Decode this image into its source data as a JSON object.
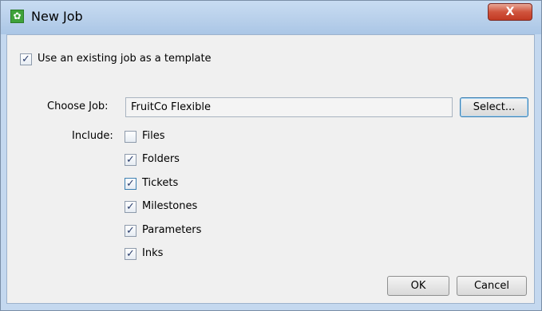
{
  "window": {
    "title": "New Job",
    "app_icon_glyph": "✿",
    "close_glyph": "X"
  },
  "template_option": {
    "label": "Use an existing job as a template",
    "checked": true
  },
  "choose_job": {
    "label": "Choose Job:",
    "value": "FruitCo Flexible",
    "select_label": "Select..."
  },
  "include": {
    "label": "Include:",
    "items": [
      {
        "label": "Files",
        "checked": false
      },
      {
        "label": "Folders",
        "checked": true
      },
      {
        "label": "Tickets",
        "checked": true
      },
      {
        "label": "Milestones",
        "checked": true
      },
      {
        "label": "Parameters",
        "checked": true
      },
      {
        "label": "Inks",
        "checked": true
      }
    ]
  },
  "buttons": {
    "ok": "OK",
    "cancel": "Cancel"
  },
  "checkmark_glyph": "✓",
  "colors": {
    "titlebar": "#b7cfea",
    "close": "#c23a23",
    "app_icon": "#3fa23a"
  }
}
